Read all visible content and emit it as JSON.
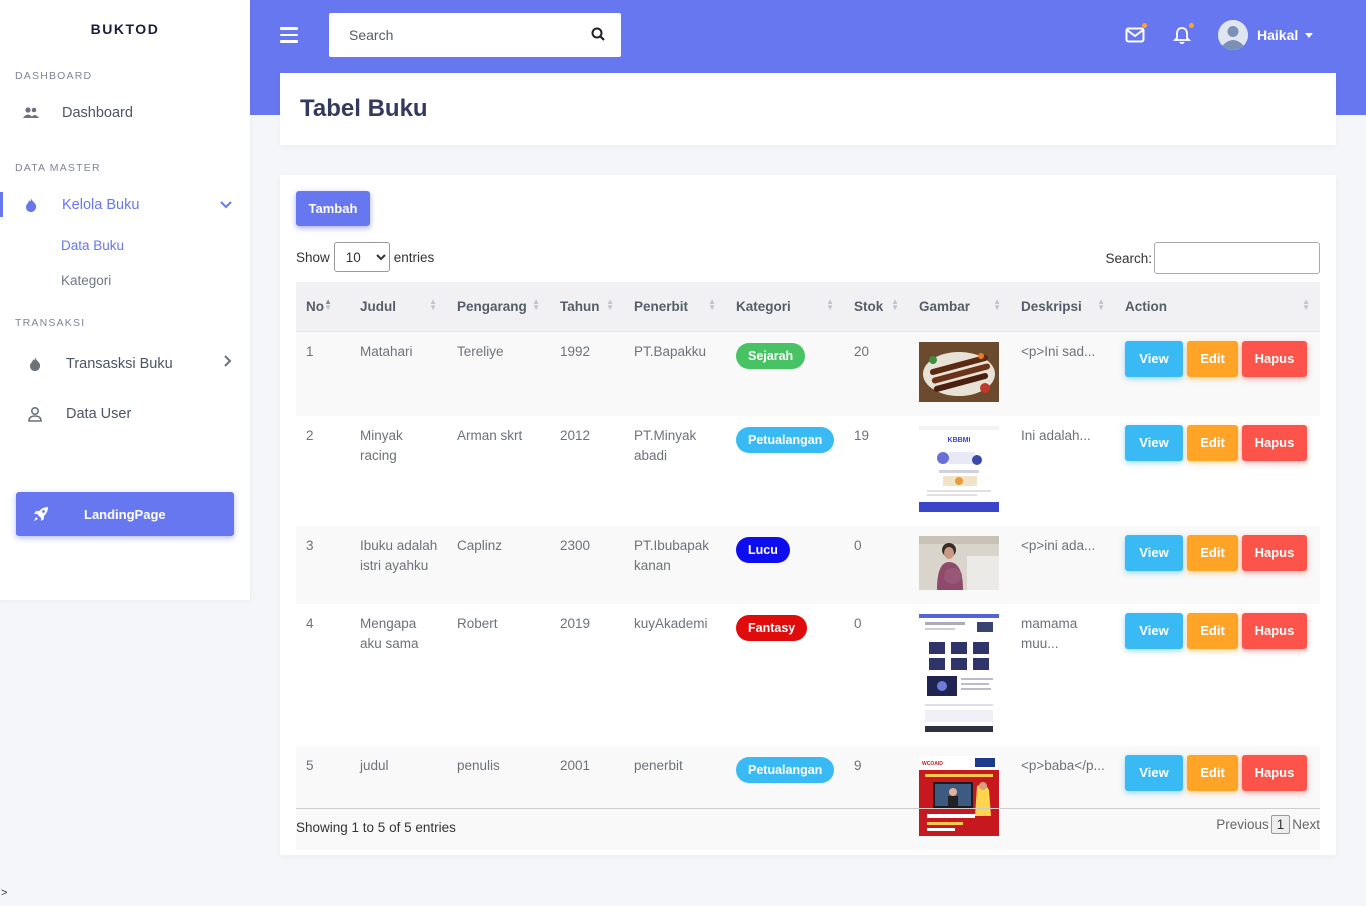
{
  "sidebar": {
    "brand": "BUKTOD",
    "sections": {
      "dashboard": "DASHBOARD",
      "data_master": "DATA MASTER",
      "transaksi": "TRANSAKSI"
    },
    "items": {
      "dashboard": "Dashboard",
      "kelola_buku": "Kelola Buku",
      "data_buku": "Data Buku",
      "kategori": "Kategori",
      "transaksi_buku": "Transasksi Buku",
      "data_user": "Data User"
    },
    "landing_button": "LandingPage"
  },
  "topbar": {
    "search_placeholder": "Search",
    "user_name": "Haikal",
    "accent": "#6777ef"
  },
  "page": {
    "title": "Tabel Buku"
  },
  "table_controls": {
    "add_button": "Tambah",
    "show_label": "Show",
    "entries_value": "10",
    "entries_label": "entries",
    "search_label": "Search:",
    "info": "Showing 1 to 5 of 5 entries",
    "prev": "Previous",
    "page": "1",
    "next": "Next"
  },
  "table": {
    "headers": [
      "No",
      "Judul",
      "Pengarang",
      "Tahun",
      "Penerbit",
      "Kategori",
      "Stok",
      "Gambar",
      "Deskripsi",
      "Action"
    ],
    "actions": {
      "view": "View",
      "edit": "Edit",
      "hapus": "Hapus"
    },
    "rows": [
      {
        "no": "1",
        "judul": "Matahari",
        "pengarang": "Tereliye",
        "tahun": "1992",
        "penerbit": "PT.Bapakku",
        "kategori": "Sejarah",
        "kategori_color": "#47c363",
        "stok": "20",
        "gambar": "food-image",
        "deskripsi": "<p>Ini sad..."
      },
      {
        "no": "2",
        "judul": "Minyak racing",
        "pengarang": "Arman skrt",
        "tahun": "2012",
        "penerbit": "PT.Minyak abadi",
        "kategori": "Petualangan",
        "kategori_color": "#3abaf4",
        "stok": "19",
        "gambar": "kbbmi-web-screenshot",
        "deskripsi": "Ini adalah..."
      },
      {
        "no": "3",
        "judul": "Ibuku adalah istri ayahku",
        "pengarang": "Caplinz",
        "tahun": "2300",
        "penerbit": "PT.Ibubapak kanan",
        "kategori": "Lucu",
        "kategori_color": "#0d0df0",
        "stok": "0",
        "gambar": "person-photo",
        "deskripsi": "<p>ini ada..."
      },
      {
        "no": "4",
        "judul": "Mengapa aku sama",
        "pengarang": "Robert",
        "tahun": "2019",
        "penerbit": "kuyAkademi",
        "kategori": "Fantasy",
        "kategori_color": "#e00b0b",
        "stok": "0",
        "gambar": "website-screenshot",
        "deskripsi": "mamama muu..."
      },
      {
        "no": "5",
        "judul": "judul",
        "pengarang": "penulis",
        "tahun": "2001",
        "penerbit": "penerbit",
        "kategori": "Petualangan",
        "kategori_color": "#3abaf4",
        "stok": "9",
        "gambar": "red-poster",
        "deskripsi": "<p>baba</p..."
      }
    ]
  },
  "stray_char": ">"
}
